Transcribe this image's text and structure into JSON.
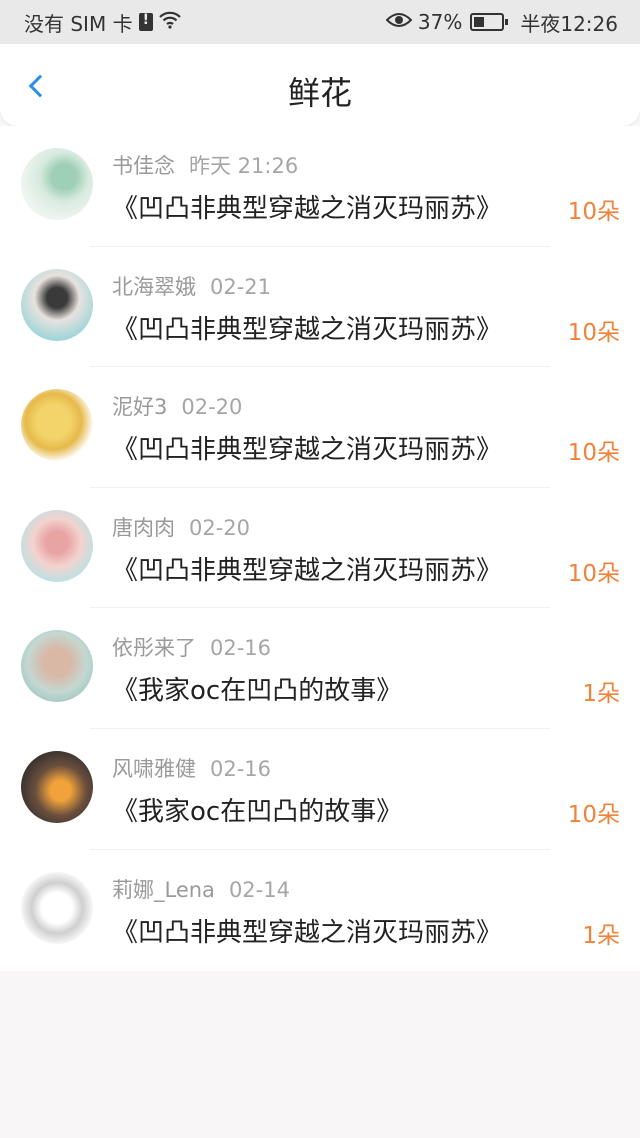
{
  "status_bar": {
    "carrier": "没有 SIM 卡",
    "battery": "37%",
    "battery_level": 0.37,
    "time": "半夜12:26",
    "icons": [
      "sim-alert-icon",
      "wifi-icon",
      "eye-icon",
      "battery-charging-icon"
    ]
  },
  "header": {
    "title": "鲜花",
    "back_icon": "chevron-left-icon",
    "accent_color": "#2a8de6"
  },
  "colors": {
    "flower_count": "#f0823a",
    "name_text": "#9a9a9a",
    "title_text": "#222222"
  },
  "items": [
    {
      "name": "书佳念",
      "date": "昨天 21:26",
      "book": "《凹凸非典型穿越之消灭玛丽苏》",
      "count": "10朵"
    },
    {
      "name": "北海翠娥",
      "date": "02-21",
      "book": "《凹凸非典型穿越之消灭玛丽苏》",
      "count": "10朵"
    },
    {
      "name": "泥好3",
      "date": "02-20",
      "book": "《凹凸非典型穿越之消灭玛丽苏》",
      "count": "10朵"
    },
    {
      "name": "唐肉肉",
      "date": "02-20",
      "book": "《凹凸非典型穿越之消灭玛丽苏》",
      "count": "10朵"
    },
    {
      "name": "依彤来了",
      "date": "02-16",
      "book": "《我家oc在凹凸的故事》",
      "count": "1朵"
    },
    {
      "name": "风啸雅健",
      "date": "02-16",
      "book": "《我家oc在凹凸的故事》",
      "count": "10朵"
    },
    {
      "name": "莉娜_Lena",
      "date": "02-14",
      "book": "《凹凸非典型穿越之消灭玛丽苏》",
      "count": "1朵"
    }
  ]
}
